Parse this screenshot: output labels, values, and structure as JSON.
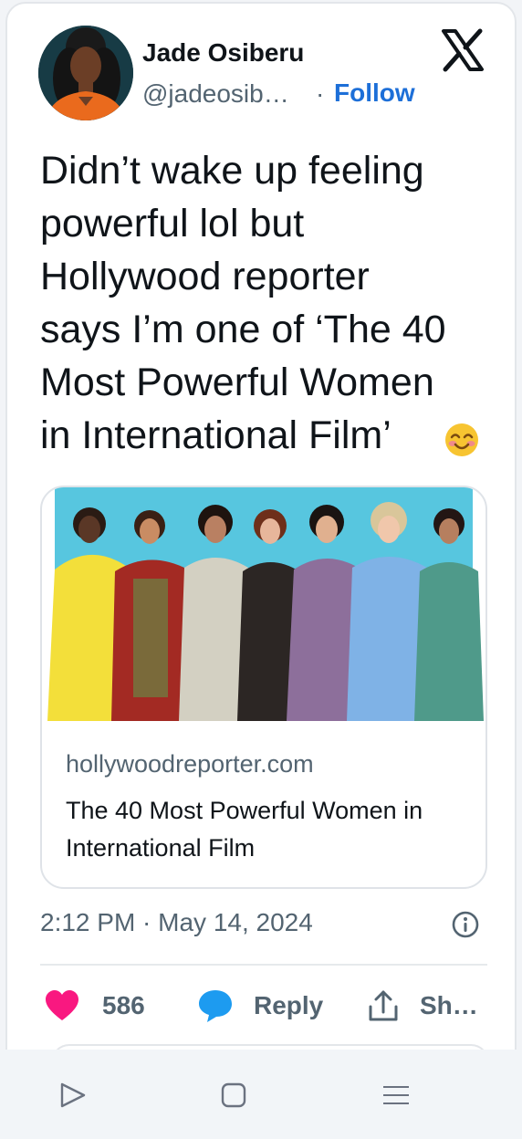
{
  "author": {
    "name": "Jade Osiberu",
    "handle": "@jadeosib…",
    "separator": "·",
    "follow_label": "Follow"
  },
  "platform_icon": "x-logo-icon",
  "tweet": {
    "text": "Didn’t wake up feeling\npowerful lol but\nHollywood reporter\nsays I’m one of ‘The 40\nMost Powerful Women\nin International Film’",
    "emoji_icon": "smiling-face-with-smiling-eyes-icon"
  },
  "link_card": {
    "domain": "hollywoodreporter.com",
    "title": "The 40 Most Powerful Women in International Film"
  },
  "meta": {
    "timestamp": "2:12 PM · May 14, 2024",
    "info_icon": "info-icon"
  },
  "actions": {
    "like_count": "586",
    "reply_label": "Reply",
    "share_label": "Sh…"
  },
  "system_nav": {
    "back_icon": "triangle-back-icon",
    "home_icon": "square-home-icon",
    "recents_icon": "lines-recents-icon"
  },
  "colors": {
    "accent_blue": "#1d6fd8",
    "like_pink": "#f91880",
    "reply_blue": "#1d9bf0",
    "text_primary": "#0f1419",
    "text_secondary": "#536471",
    "image_background": "#57c6df"
  }
}
